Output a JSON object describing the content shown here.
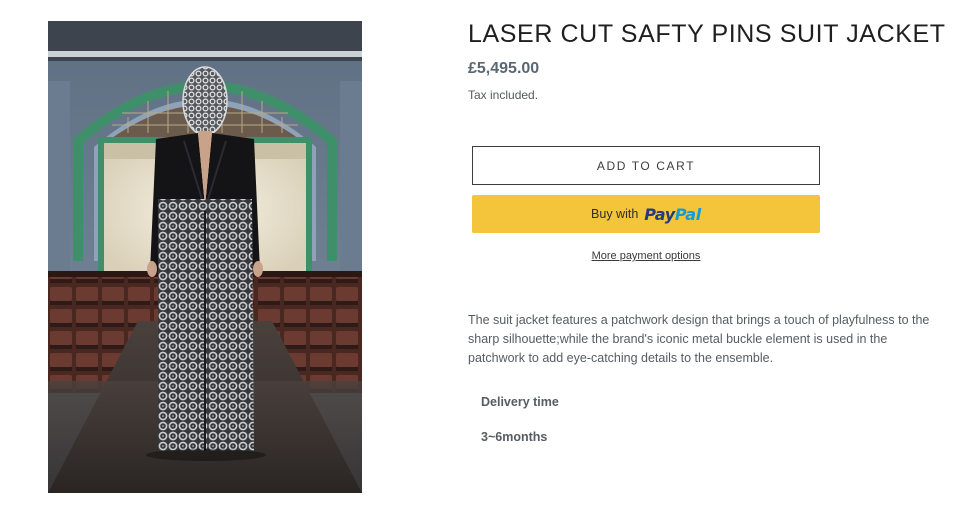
{
  "product": {
    "title": "LASER CUT SAFTY PINS SUIT JACKET",
    "price": "£5,495.00",
    "tax_note": "Tax included.",
    "add_to_cart_label": "ADD TO CART",
    "paypal": {
      "prefix": "Buy with",
      "logo_pay": "Pay",
      "logo_pal": "Pal",
      "button_color": "#f4c43a"
    },
    "more_payment_options": "More payment options",
    "description": "The suit jacket features a patchwork design that brings a touch of playfulness to the sharp silhouette;while the brand's iconic metal buckle element is used in the patchwork to add eye-catching details to the ensemble.",
    "delivery": {
      "label": "Delivery time",
      "value": "3~6months"
    }
  },
  "image": {
    "subject": "product-photo"
  }
}
